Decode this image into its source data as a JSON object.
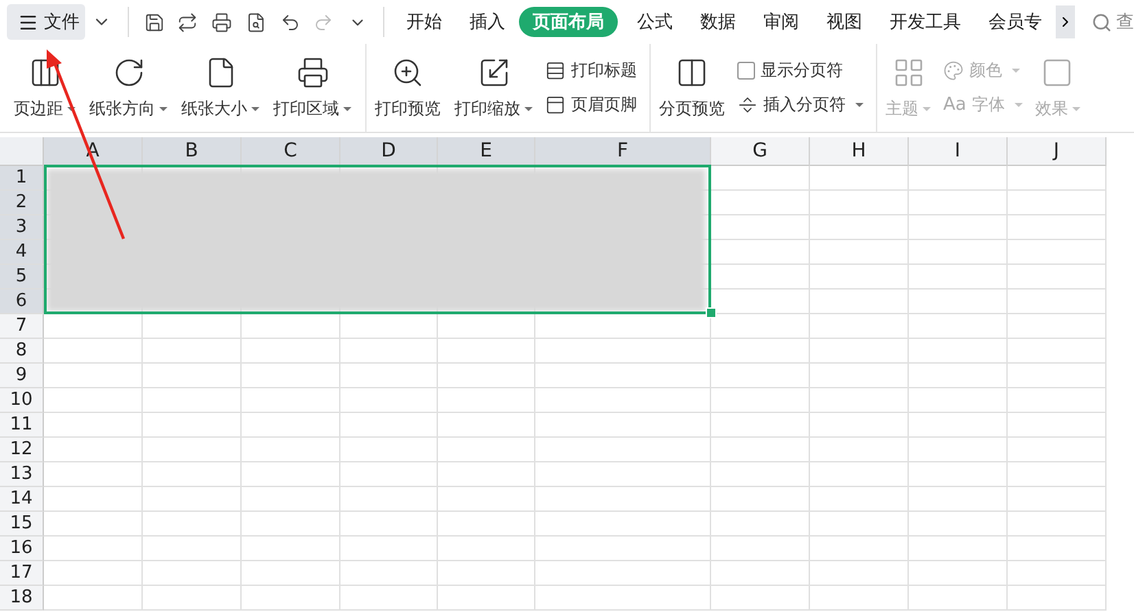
{
  "file_menu": {
    "label": "文件"
  },
  "tabs": [
    {
      "label": "开始",
      "selected": false
    },
    {
      "label": "插入",
      "selected": false
    },
    {
      "label": "页面布局",
      "selected": true
    },
    {
      "label": "公式",
      "selected": false
    },
    {
      "label": "数据",
      "selected": false
    },
    {
      "label": "审阅",
      "selected": false
    },
    {
      "label": "视图",
      "selected": false
    },
    {
      "label": "开发工具",
      "selected": false
    },
    {
      "label": "会员专",
      "selected": false
    }
  ],
  "search": {
    "placeholder": "查"
  },
  "ribbon": {
    "groups": [
      {
        "disabled": false,
        "items": [
          {
            "kind": "large",
            "label": "页边距",
            "dropdown": true
          },
          {
            "kind": "large",
            "label": "纸张方向",
            "dropdown": true
          },
          {
            "kind": "large",
            "label": "纸张大小",
            "dropdown": true
          },
          {
            "kind": "large",
            "label": "打印区域",
            "dropdown": true
          }
        ]
      },
      {
        "disabled": false,
        "items": [
          {
            "kind": "large",
            "label": "打印预览",
            "dropdown": false
          },
          {
            "kind": "large",
            "label": "打印缩放",
            "dropdown": true
          },
          {
            "kind": "small",
            "label": "打印标题",
            "dropdown": false
          },
          {
            "kind": "small",
            "label": "页眉页脚",
            "dropdown": false
          }
        ]
      },
      {
        "disabled": false,
        "items": [
          {
            "kind": "large",
            "label": "分页预览",
            "dropdown": false
          },
          {
            "kind": "checkbox",
            "label": "显示分页符",
            "checked": false
          },
          {
            "kind": "small",
            "label": "插入分页符",
            "dropdown": true
          }
        ]
      },
      {
        "disabled": true,
        "items": [
          {
            "kind": "large",
            "label": "主题",
            "dropdown": true
          },
          {
            "kind": "small",
            "label": "颜色",
            "dropdown": true
          },
          {
            "kind": "small",
            "prefix": "Aa",
            "label": "字体",
            "dropdown": true
          },
          {
            "kind": "large",
            "label": "效果",
            "dropdown": true
          }
        ]
      }
    ]
  },
  "sheet": {
    "columns": [
      "A",
      "B",
      "C",
      "D",
      "E",
      "F",
      "G",
      "H",
      "I",
      "J"
    ],
    "rows": [
      "1",
      "2",
      "3",
      "4",
      "5",
      "6",
      "7",
      "8",
      "9",
      "10",
      "11",
      "12",
      "13",
      "14",
      "15",
      "16",
      "17",
      "18"
    ]
  }
}
